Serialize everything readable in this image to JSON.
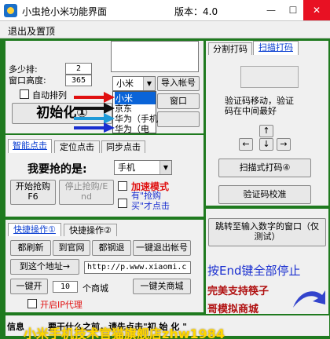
{
  "window": {
    "title": "小虫抢小米功能界面",
    "version": "版本：4.0",
    "minimize": "—",
    "maximize": "☐",
    "close": "✕"
  },
  "menu": {
    "item1": "退出及置顶"
  },
  "left": {
    "count_label": "多少排:",
    "count_value": "2",
    "height_label": "窗口高度:",
    "height_value": "365",
    "auto_arrange": "自动排列",
    "init_button": "初始化①",
    "account_select": "小米",
    "import_button": "导入帐号",
    "window_button": "窗口",
    "dropdown_options": [
      "小米",
      "京东",
      "华为（手机",
      "华为（电"
    ],
    "tabs": [
      "智能点击",
      "定位点击",
      "同步点击"
    ],
    "want_label": "我要抢的是:",
    "product_select": "手机",
    "start_button": "开始抢购\nF6",
    "stop_button": "停止抢购/E\nnd",
    "accel_label": "加速模式",
    "has_label": "有\"抢购\n买\"才点击",
    "quick_tabs": [
      "快捷操作①",
      "快捷操作②"
    ],
    "refresh_button": "都刷新",
    "official_button": "到官网",
    "logout_button": "都钢退",
    "exit_account_button": "一键退出帐号",
    "address_button": "到这个地址→",
    "address_value": "http://p.www.xiaomi.c",
    "open_button": "一键开",
    "open_count": "10",
    "open_suffix": "个商城",
    "close_shops_button": "一键关商城",
    "ip_label": "开启IP代理",
    "info_label": "信息",
    "info_text": "要干什么之前，请先点击\"初 始 化 \""
  },
  "right": {
    "tabs": [
      "分割打码",
      "扫描打码"
    ],
    "captcha_hint": "验证码移动，验证\n码在中间最好",
    "arrows": {
      "up": "↑",
      "left": "←",
      "down": "↓",
      "right": "→"
    },
    "scan_button": "扫描式打码④",
    "verify_button": "验证码校准",
    "jump_button": "跳转至输入数字的窗口（仅\n测试）",
    "end_key_text": "按End键全部停止",
    "support_text": "完美支持筷子",
    "simulate_text": "哥模拟商城"
  },
  "overlay": {
    "text": "小米手机技术官猫旗舰店zhw1984"
  }
}
